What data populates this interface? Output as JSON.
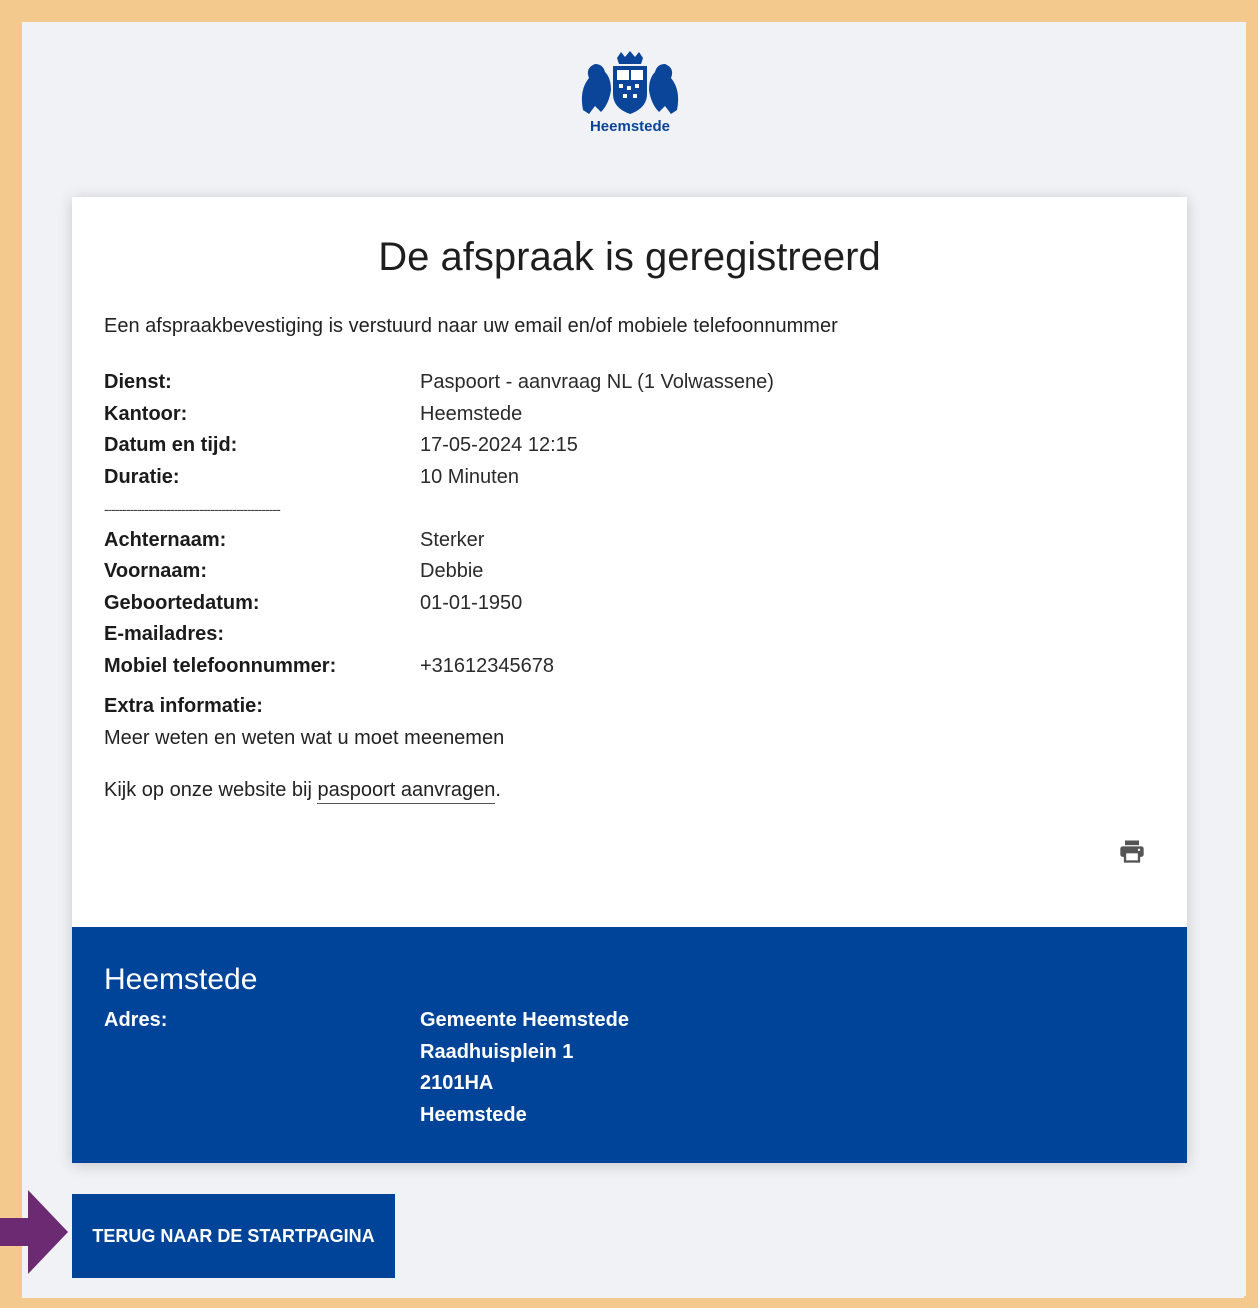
{
  "header": {
    "logo_text": "Heemstede"
  },
  "card": {
    "title": "De afspraak is geregistreerd",
    "intro": "Een afspraakbevestiging is verstuurd naar uw email en/of mobiele telefoonnummer",
    "appointment": [
      {
        "label": "Dienst:",
        "value": "Paspoort - aanvraag NL (1 Volwassene)"
      },
      {
        "label": "Kantoor:",
        "value": "Heemstede"
      },
      {
        "label": "Datum en tijd:",
        "value": "17-05-2024 12:15"
      },
      {
        "label": "Duratie:",
        "value": "10 Minuten"
      }
    ],
    "separator": "------------------------------------------------",
    "person": [
      {
        "label": "Achternaam:",
        "value": "Sterker"
      },
      {
        "label": "Voornaam:",
        "value": "Debbie"
      },
      {
        "label": "Geboortedatum:",
        "value": "01-01-1950"
      },
      {
        "label": "E-mailadres:",
        "value": ""
      },
      {
        "label": "Mobiel telefoonnummer:",
        "value": "+31612345678"
      }
    ],
    "extra_title": "Extra informatie:",
    "extra_text": "Meer weten en weten wat u moet meenemen",
    "website_prefix": "Kijk op onze website bij ",
    "website_link": "paspoort aanvragen",
    "website_suffix": ".",
    "print_icon": "printer-icon"
  },
  "footer": {
    "title": "Heemstede",
    "address_label": "Adres:",
    "address_lines": [
      "Gemeente Heemstede",
      "Raadhuisplein 1",
      "2101HA",
      "Heemstede"
    ]
  },
  "actions": {
    "back_label": "TERUG NAAR DE STARTPAGINA"
  },
  "colors": {
    "brand_blue": "#00449a",
    "frame_orange": "#f4c98e",
    "arrow_purple": "#6b2a72",
    "page_bg": "#f1f2f6"
  }
}
